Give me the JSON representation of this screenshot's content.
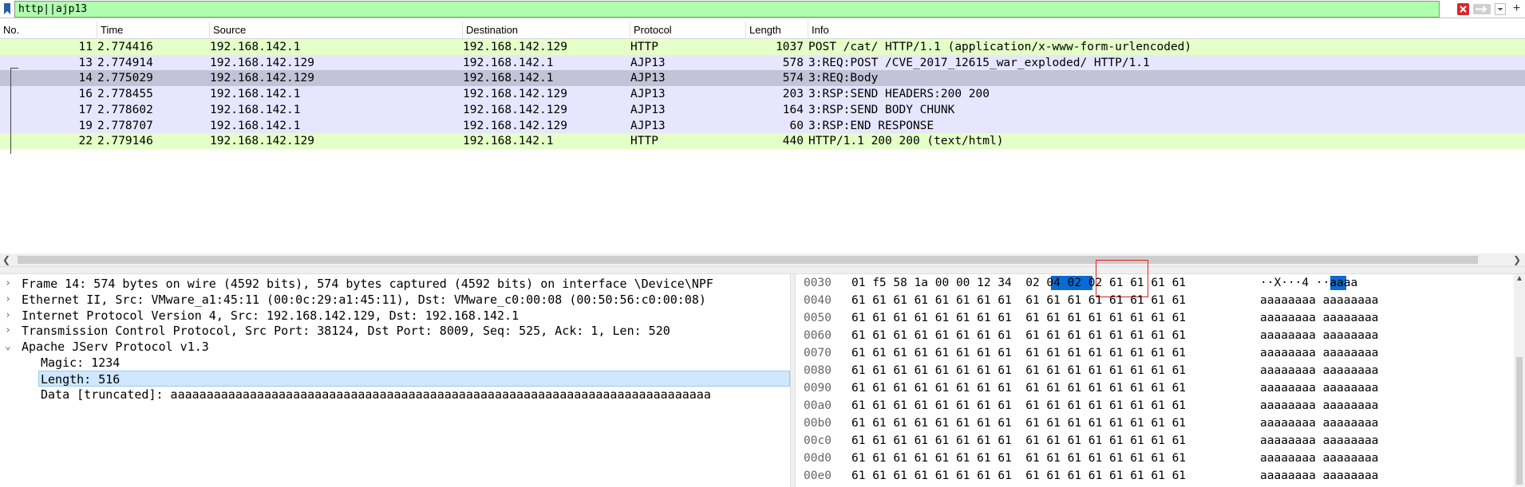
{
  "filter": {
    "value": "http||ajp13",
    "add_label": "+"
  },
  "packet_list": {
    "columns": [
      "No.",
      "Time",
      "Source",
      "Destination",
      "Protocol",
      "Length",
      "Info"
    ],
    "rows": [
      {
        "no": "11",
        "time": "2.774416",
        "src": "192.168.142.1",
        "dst": "192.168.142.129",
        "proto": "HTTP",
        "len": "1037",
        "info": "POST /cat/ HTTP/1.1  (application/x-www-form-urlencoded)",
        "color": "#e4ffc7"
      },
      {
        "no": "13",
        "time": "2.774914",
        "src": "192.168.142.129",
        "dst": "192.168.142.1",
        "proto": "AJP13",
        "len": "578",
        "info": "3:REQ:POST /CVE_2017_12615_war_exploded/ HTTP/1.1",
        "color": "#e7e6ff"
      },
      {
        "no": "14",
        "time": "2.775029",
        "src": "192.168.142.129",
        "dst": "192.168.142.1",
        "proto": "AJP13",
        "len": "574",
        "info": "3:REQ:Body",
        "color": "#c3c3d7"
      },
      {
        "no": "16",
        "time": "2.778455",
        "src": "192.168.142.1",
        "dst": "192.168.142.129",
        "proto": "AJP13",
        "len": "203",
        "info": "3:RSP:SEND HEADERS:200 200",
        "color": "#e7e6ff"
      },
      {
        "no": "17",
        "time": "2.778602",
        "src": "192.168.142.1",
        "dst": "192.168.142.129",
        "proto": "AJP13",
        "len": "164",
        "info": "3:RSP:SEND BODY CHUNK",
        "color": "#e7e6ff"
      },
      {
        "no": "19",
        "time": "2.778707",
        "src": "192.168.142.1",
        "dst": "192.168.142.129",
        "proto": "AJP13",
        "len": "60",
        "info": "3:RSP:END RESPONSE",
        "color": "#e7e6ff"
      },
      {
        "no": "22",
        "time": "2.779146",
        "src": "192.168.142.129",
        "dst": "192.168.142.1",
        "proto": "HTTP",
        "len": "440",
        "info": "HTTP/1.1 200 200  (text/html)",
        "color": "#e4ffc7"
      }
    ]
  },
  "details": [
    {
      "expander": "›",
      "indent": 0,
      "text": "Frame 14: 574 bytes on wire (4592 bits), 574 bytes captured (4592 bits) on interface \\Device\\NPF",
      "selected": false
    },
    {
      "expander": "›",
      "indent": 0,
      "text": "Ethernet II, Src: VMware_a1:45:11 (00:0c:29:a1:45:11), Dst: VMware_c0:00:08 (00:50:56:c0:00:08)",
      "selected": false
    },
    {
      "expander": "›",
      "indent": 0,
      "text": "Internet Protocol Version 4, Src: 192.168.142.129, Dst: 192.168.142.1",
      "selected": false
    },
    {
      "expander": "›",
      "indent": 0,
      "text": "Transmission Control Protocol, Src Port: 38124, Dst Port: 8009, Seq: 525, Ack: 1, Len: 520",
      "selected": false
    },
    {
      "expander": "⌄",
      "indent": 0,
      "text": "Apache JServ Protocol v1.3",
      "selected": false
    },
    {
      "expander": "",
      "indent": 1,
      "text": "Magic: 1234",
      "selected": false
    },
    {
      "expander": "",
      "indent": 1,
      "text": "Length: 516",
      "selected": true
    },
    {
      "expander": "",
      "indent": 1,
      "text": "Data [truncated]: aaaaaaaaaaaaaaaaaaaaaaaaaaaaaaaaaaaaaaaaaaaaaaaaaaaaaaaaaaaaaaaaaaaaaaaaaaa",
      "selected": false
    }
  ],
  "bytes": [
    {
      "off": "0030",
      "hex": "01 f5 58 1a 00 00 12 34  02 04 02 02 61 61 61 61",
      "ascii": "··X···4 ··aaaa"
    },
    {
      "off": "0040",
      "hex": "61 61 61 61 61 61 61 61  61 61 61 61 61 61 61 61",
      "ascii": "aaaaaaaa aaaaaaaa"
    },
    {
      "off": "0050",
      "hex": "61 61 61 61 61 61 61 61  61 61 61 61 61 61 61 61",
      "ascii": "aaaaaaaa aaaaaaaa"
    },
    {
      "off": "0060",
      "hex": "61 61 61 61 61 61 61 61  61 61 61 61 61 61 61 61",
      "ascii": "aaaaaaaa aaaaaaaa"
    },
    {
      "off": "0070",
      "hex": "61 61 61 61 61 61 61 61  61 61 61 61 61 61 61 61",
      "ascii": "aaaaaaaa aaaaaaaa"
    },
    {
      "off": "0080",
      "hex": "61 61 61 61 61 61 61 61  61 61 61 61 61 61 61 61",
      "ascii": "aaaaaaaa aaaaaaaa"
    },
    {
      "off": "0090",
      "hex": "61 61 61 61 61 61 61 61  61 61 61 61 61 61 61 61",
      "ascii": "aaaaaaaa aaaaaaaa"
    },
    {
      "off": "00a0",
      "hex": "61 61 61 61 61 61 61 61  61 61 61 61 61 61 61 61",
      "ascii": "aaaaaaaa aaaaaaaa"
    },
    {
      "off": "00b0",
      "hex": "61 61 61 61 61 61 61 61  61 61 61 61 61 61 61 61",
      "ascii": "aaaaaaaa aaaaaaaa"
    },
    {
      "off": "00c0",
      "hex": "61 61 61 61 61 61 61 61  61 61 61 61 61 61 61 61",
      "ascii": "aaaaaaaa aaaaaaaa"
    },
    {
      "off": "00d0",
      "hex": "61 61 61 61 61 61 61 61  61 61 61 61 61 61 61 61",
      "ascii": "aaaaaaaa aaaaaaaa"
    },
    {
      "off": "00e0",
      "hex": "61 61 61 61 61 61 61 61  61 61 61 61 61 61 61 61",
      "ascii": "aaaaaaaa aaaaaaaa"
    }
  ],
  "colors": {
    "filter_valid": "#afffaf",
    "http_row": "#e4ffc7",
    "ajp_row": "#e7e6ff",
    "selected_row": "#c3c3d7",
    "byte_highlight": "#0a6bd6",
    "annotation_box": "#e02020"
  }
}
